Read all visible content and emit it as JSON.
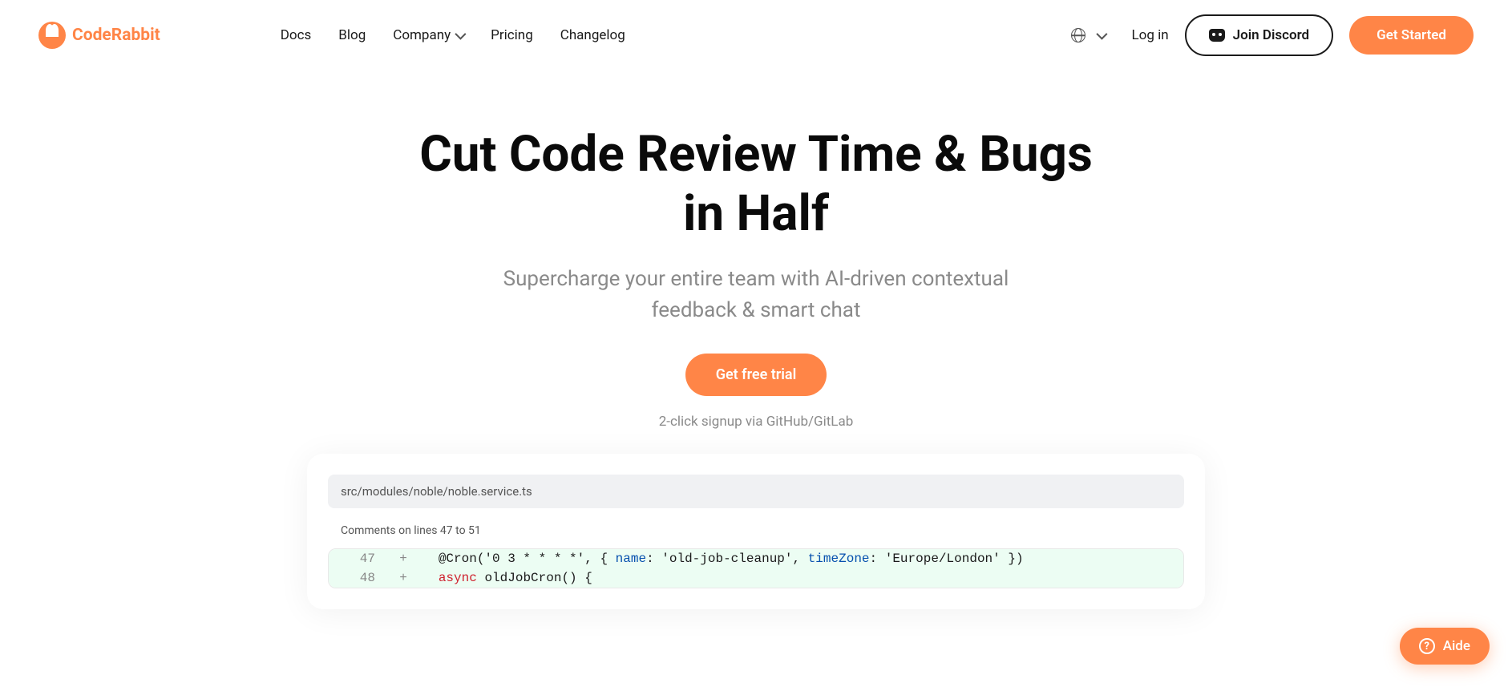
{
  "brand": {
    "name": "CodeRabbit"
  },
  "nav": {
    "docs": "Docs",
    "blog": "Blog",
    "company": "Company",
    "pricing": "Pricing",
    "changelog": "Changelog"
  },
  "header": {
    "login": "Log in",
    "join_discord": "Join Discord",
    "get_started": "Get Started"
  },
  "hero": {
    "title": "Cut Code Review Time & Bugs in Half",
    "subtitle": "Supercharge your entire team with AI-driven contextual feedback & smart chat",
    "cta": "Get free trial",
    "note": "2-click signup via GitHub/GitLab"
  },
  "code_preview": {
    "file_path": "src/modules/noble/noble.service.ts",
    "comments_label": "Comments on lines 47 to 51",
    "lines": [
      {
        "num": "47",
        "content": "@Cron('0 3 * * * *', { name: 'old-job-cleanup', timeZone: 'Europe/London' })"
      },
      {
        "num": "48",
        "content": "async oldJobCron() {"
      }
    ]
  },
  "help": {
    "label": "Aide"
  }
}
